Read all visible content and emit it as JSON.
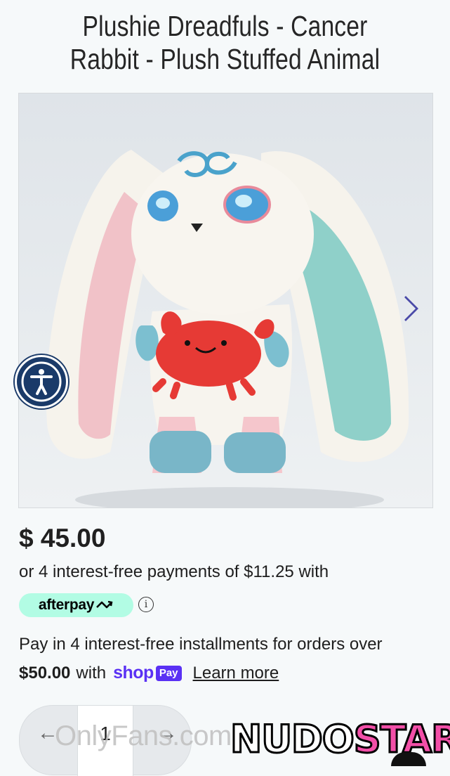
{
  "product": {
    "title": "Plushie Dreadfuls - Cancer Rabbit - Plush Stuffed Animal",
    "image_alt": "Cancer Rabbit plush holding a red crab",
    "price": "$ 45.00"
  },
  "afterpay": {
    "installments_text": "or 4 interest-free payments of $11.25 with",
    "badge_label": "afterpay"
  },
  "shop_pay": {
    "line1": "Pay in 4 interest-free installments for orders over",
    "threshold": "$50.00",
    "with_text": "with",
    "shop_word": "shop",
    "pay_word": "Pay",
    "learn_more": "Learn more"
  },
  "quantity": {
    "minus_glyph": "←",
    "value": "1",
    "plus_glyph": "→"
  },
  "watermarks": {
    "onlyfans": "OnlyFans.com",
    "nudo": "NUDO",
    "star": "STAR"
  },
  "colors": {
    "background": "#f6f9fa",
    "afterpay_mint": "#b2fce4",
    "shop_pay_purple": "#5a31f4",
    "accessibility_navy": "#1a3a69",
    "carousel_arrow": "#4a4aa8"
  },
  "icons": {
    "carousel_next": "chevron-right-icon",
    "accessibility": "accessibility-icon",
    "info": "info-icon",
    "afterpay_logo": "afterpay-arrows-icon"
  }
}
